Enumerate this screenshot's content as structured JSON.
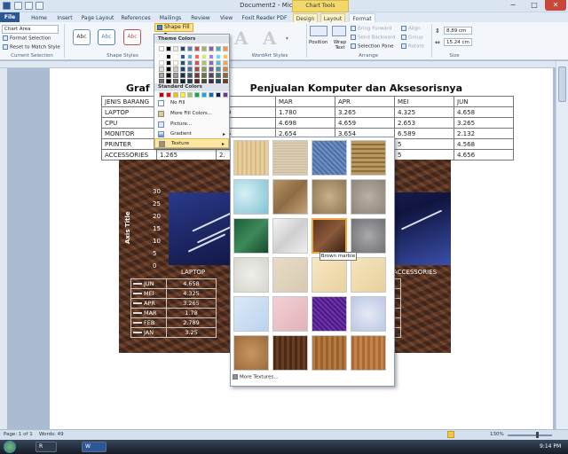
{
  "window": {
    "title": "Document2 - Microsoft Word",
    "context_tab_header": "Chart Tools",
    "minimize": "−",
    "maximize": "□",
    "close": "✕"
  },
  "tabs": [
    {
      "label": "File",
      "selected": false
    },
    {
      "label": "Home"
    },
    {
      "label": "Insert"
    },
    {
      "label": "Page Layout"
    },
    {
      "label": "References"
    },
    {
      "label": "Mailings"
    },
    {
      "label": "Review"
    },
    {
      "label": "View"
    },
    {
      "label": "Foxit Reader PDF"
    },
    {
      "label": "Design"
    },
    {
      "label": "Layout"
    },
    {
      "label": "Format"
    }
  ],
  "ribbon": {
    "current_selection": {
      "value": "Chart Area",
      "format_selection": "Format Selection",
      "reset": "Reset to Match Style",
      "group": "Current Selection"
    },
    "shape_styles": {
      "style_label": "Abc",
      "group": "Shape Styles",
      "shape_fill": "Shape Fill"
    },
    "wordart": {
      "letter": "A",
      "group": "WordArt Styles"
    },
    "arrange": {
      "position": "Position",
      "wrap_text": "Wrap Text",
      "bring_forward": "Bring Forward",
      "send_backward": "Send Backward",
      "selection_pane": "Selection Pane",
      "align": "Align",
      "group_btn": "Group",
      "rotate": "Rotate",
      "group": "Arrange"
    },
    "size": {
      "height": "8.89 cm",
      "width": "15.24 cm",
      "group": "Size"
    }
  },
  "document": {
    "heading": "Grafik Penjualan Komputer dan Aksesorisnya",
    "heading_visible_left": "Graf",
    "heading_visible_right": "Penjualan Komputer dan Aksesorisnya",
    "table": [
      [
        "JENIS BARANG",
        "",
        "",
        "MAR",
        "APR",
        "MEI",
        "JUN"
      ],
      [
        "LAPTOP",
        "",
        "789",
        "1.780",
        "3.265",
        "4.325",
        "4.658"
      ],
      [
        "CPU",
        "",
        "48",
        "4.698",
        "4.659",
        "2.653",
        "3.265"
      ],
      [
        "MONITOR",
        "",
        "265",
        "2.654",
        "3.654",
        "6.589",
        "2.132"
      ],
      [
        "PRINTER",
        "",
        "",
        "",
        "",
        "5",
        "4.568"
      ],
      [
        "ACCESSORIES",
        "1.265",
        "2.",
        "",
        "",
        "5",
        "4.656"
      ]
    ]
  },
  "chart": {
    "axis_title": "Axis Title",
    "y_ticks": [
      "30",
      "25",
      "20",
      "15",
      "10",
      "5",
      "0"
    ],
    "categories_visible": [
      "LAPTOP",
      "ACCESSORIES"
    ],
    "table_rows": [
      {
        "label": "JUN",
        "laptop": "4.658",
        "accessories": "4.656"
      },
      {
        "label": "MEI",
        "laptop": "4.325",
        "accessories": "3.265"
      },
      {
        "label": "APR",
        "laptop": "3.265",
        "accessories": "2.265"
      },
      {
        "label": "MAR",
        "laptop": "1.78",
        "accessories": "2.265"
      },
      {
        "label": "FEB",
        "laptop": "2.789",
        "accessories": "2.365"
      },
      {
        "label": "JAN",
        "laptop": "3.25",
        "accessories": "1.265"
      }
    ]
  },
  "fill_menu": {
    "theme_colors": "Theme Colors",
    "standard_colors": "Standard Colors",
    "items": [
      {
        "label": "No Fill"
      },
      {
        "label": "More Fill Colors..."
      },
      {
        "label": "Picture..."
      },
      {
        "label": "Gradient"
      },
      {
        "label": "Texture"
      }
    ],
    "theme_palette": [
      "#ffffff",
      "#000000",
      "#eeece1",
      "#1f497d",
      "#4f81bd",
      "#c0504d",
      "#9bbb59",
      "#8064a2",
      "#4bacc6",
      "#f79646"
    ],
    "standard_palette": [
      "#c00000",
      "#ff0000",
      "#ffc000",
      "#ffff00",
      "#92d050",
      "#00b050",
      "#00b0f0",
      "#0070c0",
      "#002060",
      "#7030a0"
    ]
  },
  "texture_panel": {
    "tooltip": "Brown marble",
    "more": "More Textures...",
    "textures": [
      "papyrus",
      "canvas",
      "denim",
      "woven-mat",
      "water-droplets",
      "paper-bag",
      "fish-fossil",
      "sand",
      "green-marble",
      "white-marble",
      "brown-marble",
      "granite",
      "newsprint",
      "recycled-paper",
      "parchment",
      "stationery",
      "blue-tissue-paper",
      "pink-tissue-paper",
      "purple-mesh",
      "bouquet",
      "cork",
      "walnut",
      "oak",
      "medium-wood"
    ],
    "selected": "brown-marble"
  },
  "status": {
    "page": "Page: 1 of 1",
    "words": "Words: 49",
    "zoom": "130%"
  },
  "taskbar": {
    "clock": "9:14 PM",
    "apps": [
      "R",
      "W"
    ]
  }
}
